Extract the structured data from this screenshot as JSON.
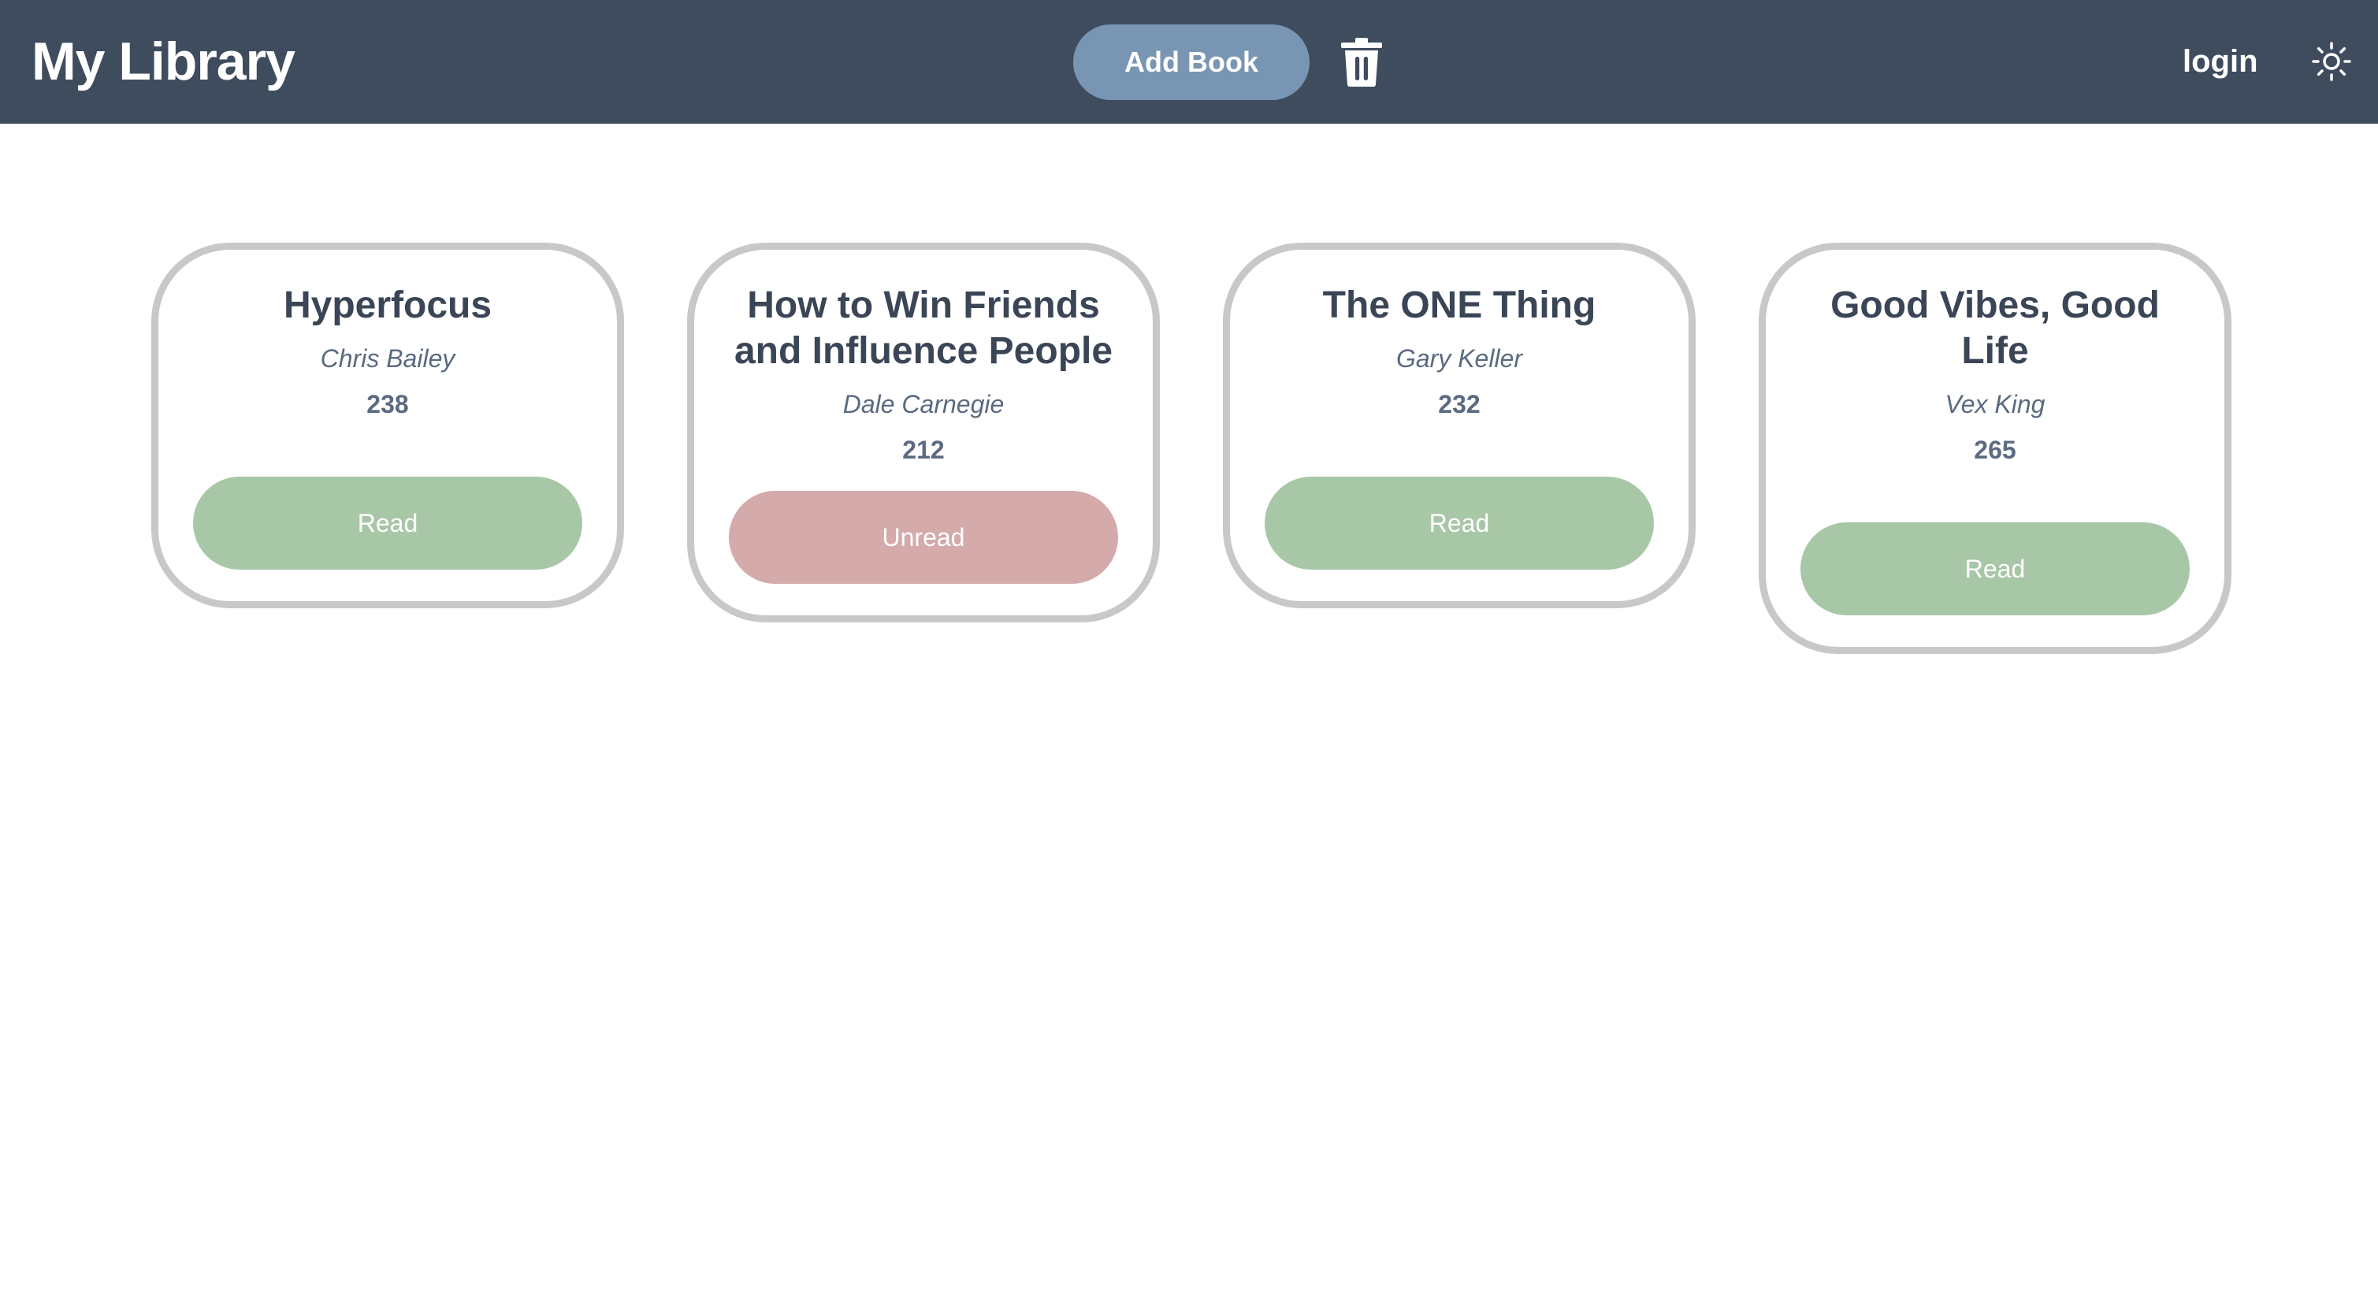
{
  "header": {
    "brand": "My Library",
    "add_book_label": "Add Book",
    "trash_icon": "trash-icon",
    "login_label": "login",
    "theme_icon": "sun-icon"
  },
  "books": [
    {
      "title": "Hyperfocus",
      "author": "Chris Bailey",
      "pages": "238",
      "status": "Read"
    },
    {
      "title": "How to Win Friends and Influence People",
      "author": "Dale Carnegie",
      "pages": "212",
      "status": "Unread"
    },
    {
      "title": "The ONE Thing",
      "author": "Gary Keller",
      "pages": "232",
      "status": "Read"
    },
    {
      "title": "Good Vibes, Good Life",
      "author": "Vex King",
      "pages": "265",
      "status": "Read"
    }
  ],
  "colors": {
    "navbar": "#3e4c5e",
    "add_button": "#7896b3",
    "read": "#a8c7a6",
    "unread": "#d4aaaa",
    "card_border": "#c8c8c8"
  }
}
